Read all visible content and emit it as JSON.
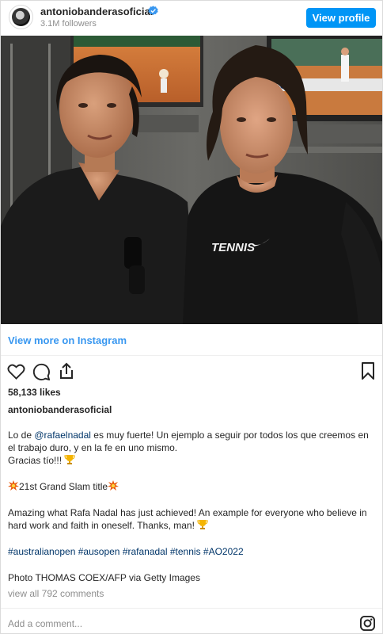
{
  "header": {
    "username": "antoniobanderasoficial",
    "followers": "3.1M followers",
    "view_profile_label": "View profile"
  },
  "photo": {
    "shirt_text": "TENNIS"
  },
  "view_more_label": "View more on Instagram",
  "likes": "58,133 likes",
  "caption_username": "antoniobanderasoficial",
  "caption": {
    "line1_prefix": "Lo de ",
    "mention": "@rafaelnadal",
    "line1_rest": " es muy fuerte! Un ejemplo a seguir por todos los que creemos en el trabajo duro, y en la fe en uno mismo.",
    "line2": "Gracias tío!!! ",
    "grand_slam": "21st Grand Slam title",
    "english": "Amazing what Rafa Nadal has just achieved! An example for everyone who believe in hard work and faith in oneself. Thanks, man! ",
    "hashtags": [
      "#australianopen",
      "#ausopen",
      "#rafanadal",
      "#tennis",
      "#AO2022"
    ],
    "credit": "Photo THOMAS COEX/AFP via Getty Images"
  },
  "view_all_comments": "view all 792 comments",
  "comment_placeholder": "Add a comment...",
  "colors": {
    "accent": "#0095f6",
    "link": "#3897f0",
    "muted": "#8e8e8e"
  },
  "icons": [
    "verified-badge-icon",
    "heart-icon",
    "comment-icon",
    "share-icon",
    "bookmark-icon",
    "instagram-icon",
    "trophy-icon",
    "explosion-icon"
  ]
}
